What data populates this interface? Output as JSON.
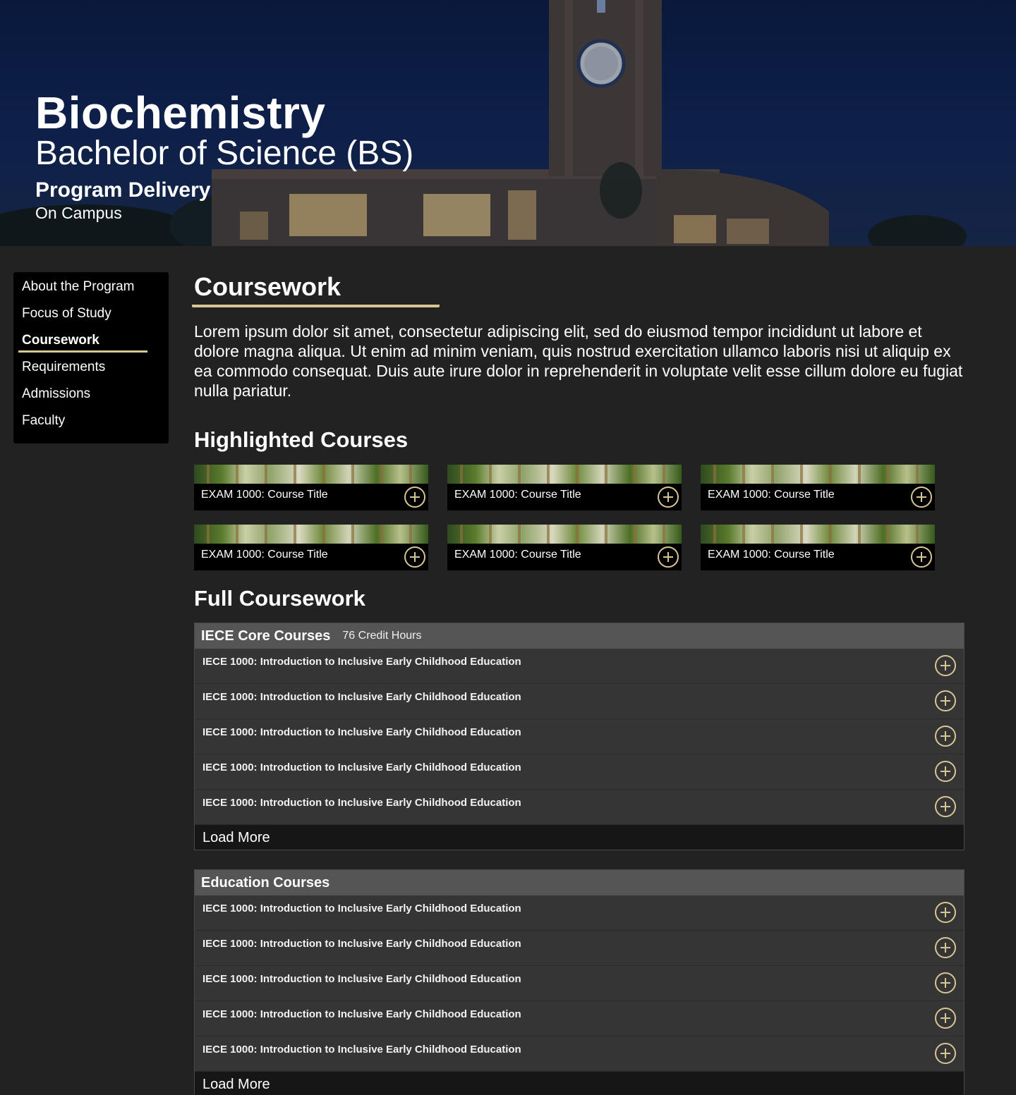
{
  "hero": {
    "title": "Biochemistry",
    "subtitle": "Bachelor of Science (BS)",
    "delivery_label": "Program Delivery",
    "delivery_value": "On Campus"
  },
  "sidebar": {
    "items": [
      {
        "label": "About the Program"
      },
      {
        "label": "Focus of Study"
      },
      {
        "label": "Coursework",
        "active": true
      },
      {
        "label": "Requirements"
      },
      {
        "label": "Admissions"
      },
      {
        "label": "Faculty"
      }
    ]
  },
  "main": {
    "heading": "Coursework",
    "intro": "Lorem ipsum dolor sit amet, consectetur adipiscing elit, sed do eiusmod  tempor incididunt ut labore et dolore magna aliqua. Ut enim ad minim  veniam, quis nostrud exercitation ullamco laboris nisi ut aliquip ex ea  commodo consequat. Duis aute irure dolor in reprehenderit in voluptate  velit esse cillum dolore eu fugiat nulla pariatur.",
    "highlighted_heading": "Highlighted Courses",
    "highlighted": [
      "EXAM 1000: Course Title",
      "EXAM 1000: Course Title",
      "EXAM 1000: Course Title",
      "EXAM 1000: Course Title",
      "EXAM 1000: Course Title",
      "EXAM 1000: Course Title"
    ],
    "full_heading": "Full Coursework",
    "groups": [
      {
        "name": "IECE Core Courses",
        "hours": "76 Credit Hours",
        "courses": [
          "IECE 1000: Introduction to Inclusive Early Childhood Education",
          "IECE 1000: Introduction to Inclusive Early Childhood Education",
          "IECE 1000: Introduction to Inclusive Early Childhood Education",
          "IECE 1000: Introduction to Inclusive Early Childhood Education",
          "IECE 1000: Introduction to Inclusive Early Childhood Education"
        ],
        "load_more": "Load More"
      },
      {
        "name": "Education Courses",
        "hours": "",
        "courses": [
          "IECE 1000: Introduction to Inclusive Early Childhood Education",
          "IECE 1000: Introduction to Inclusive Early Childhood Education",
          "IECE 1000: Introduction to Inclusive Early Childhood Education",
          "IECE 1000: Introduction to Inclusive Early Childhood Education",
          "IECE 1000: Introduction to Inclusive Early Childhood Education"
        ],
        "load_more": "Load More"
      }
    ]
  },
  "colors": {
    "accent": "#d8c594",
    "background": "#222222",
    "panel": "#000000",
    "group_header": "#555555",
    "row": "#353535"
  },
  "icons": {
    "expand": "plus-circle-icon"
  }
}
